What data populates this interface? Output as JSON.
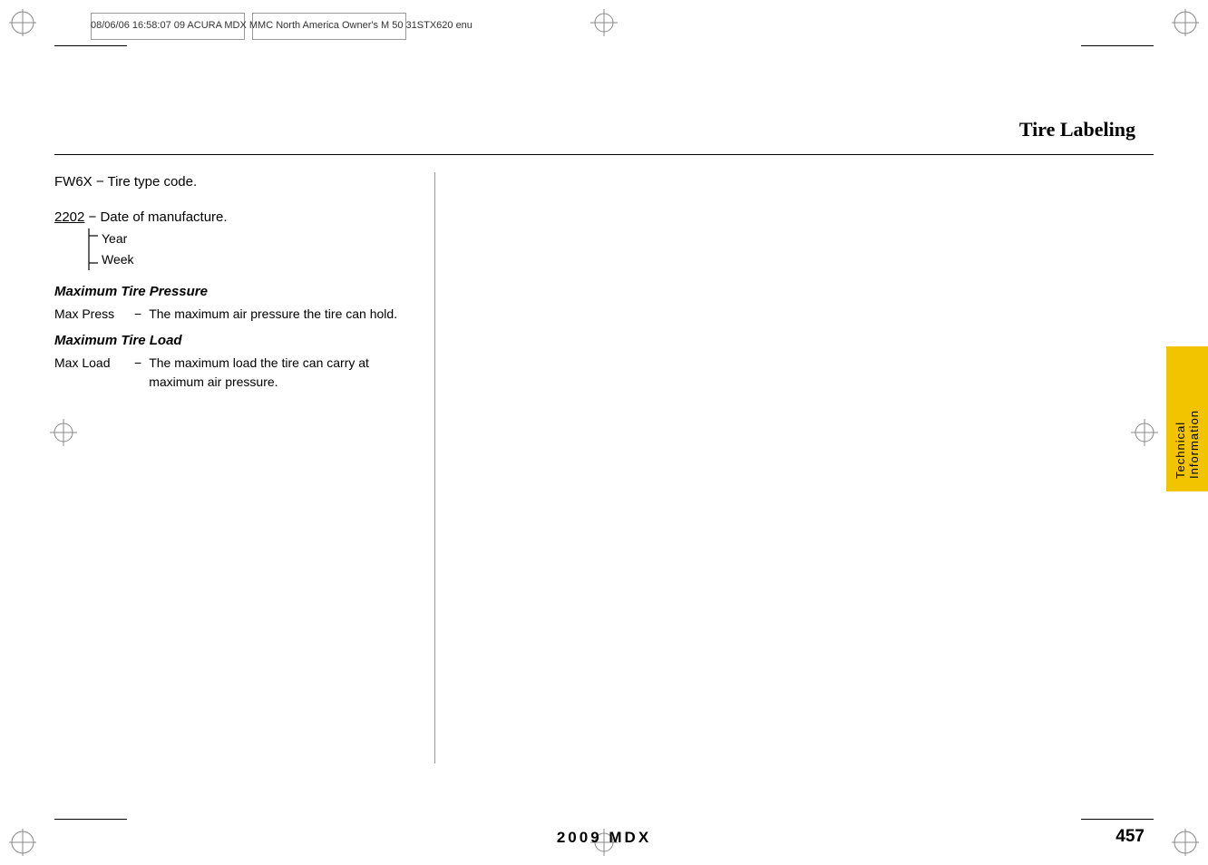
{
  "page": {
    "file_info": "08/06/06  16:58:07    09 ACURA MDX MMC North America Owner's M 50 31STX620 enu",
    "title": "Tire Labeling",
    "page_number": "457",
    "footer_text": "2009  MDX"
  },
  "sidebar": {
    "label": "Technical Information"
  },
  "nav_boxes": [
    {
      "label": ""
    },
    {
      "label": ""
    }
  ],
  "content": {
    "code_line": "FW6X  −  Tire type code.",
    "date_line": "2202  −  Date of manufacture.",
    "year_label": "Year",
    "week_label": "Week",
    "max_pressure_heading": "Maximum Tire Pressure",
    "max_press_term": "Max Press",
    "max_press_dash": "−",
    "max_press_desc": "The maximum air pressure the tire can hold.",
    "max_load_heading": "Maximum Tire Load",
    "max_load_term": "Max Load",
    "max_load_dash": "−",
    "max_load_desc": "The maximum load the tire can carry at maximum air pressure."
  }
}
